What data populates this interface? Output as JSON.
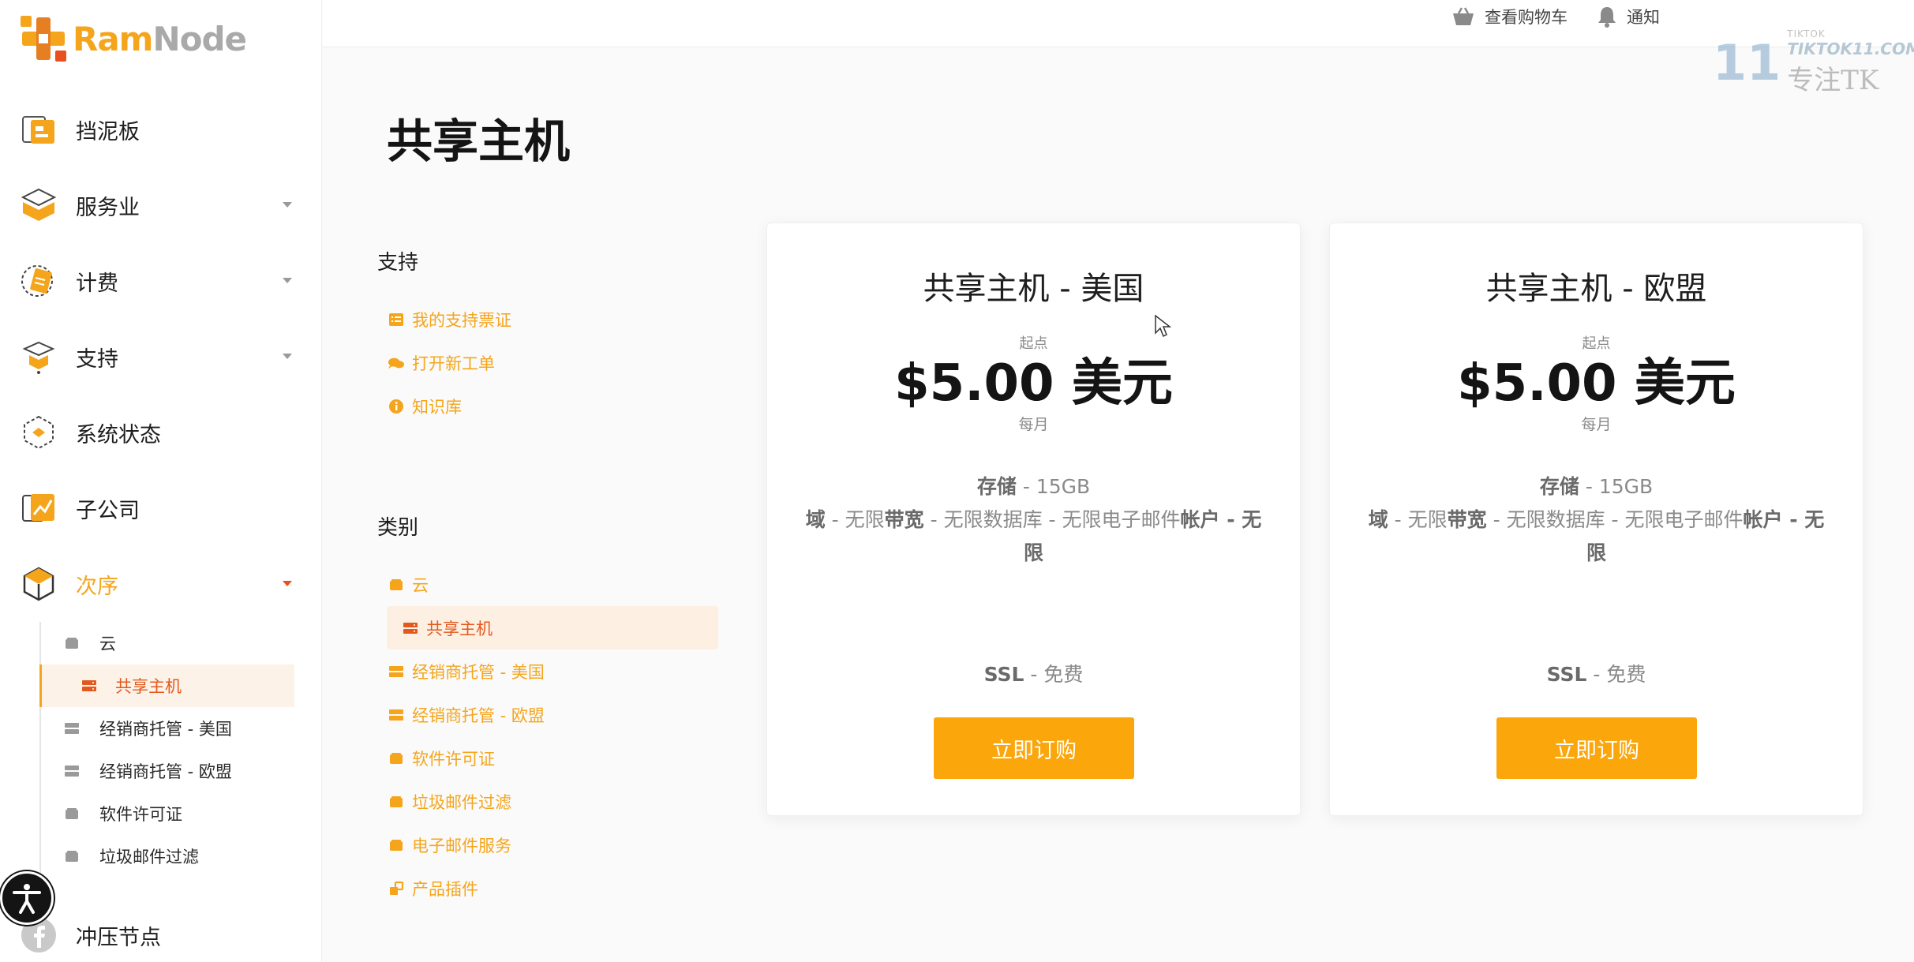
{
  "brand": {
    "name_part1": "Ram",
    "name_part2": "Node",
    "accent": "#f5a51c",
    "secondary": "#e2591e"
  },
  "sidebar": {
    "items": [
      {
        "label": "挡泥板",
        "icon": "dashboard-icon",
        "expandable": false
      },
      {
        "label": "服务业",
        "icon": "services-box-icon",
        "expandable": true
      },
      {
        "label": "计费",
        "icon": "billing-icon",
        "expandable": true
      },
      {
        "label": "支持",
        "icon": "support-icon",
        "expandable": true
      },
      {
        "label": "系统状态",
        "icon": "system-status-icon",
        "expandable": false
      },
      {
        "label": "子公司",
        "icon": "affiliate-icon",
        "expandable": false
      },
      {
        "label": "次序",
        "icon": "order-cube-icon",
        "expandable": true,
        "active": true
      }
    ],
    "subitems": [
      {
        "label": "云",
        "icon": "box-icon"
      },
      {
        "label": "共享主机",
        "icon": "server-icon",
        "active": true
      },
      {
        "label": "经销商托管 - 美国",
        "icon": "server-icon"
      },
      {
        "label": "经销商托管 - 欧盟",
        "icon": "server-icon"
      },
      {
        "label": "软件许可证",
        "icon": "box-icon"
      },
      {
        "label": "垃圾邮件过滤",
        "icon": "box-icon"
      }
    ],
    "bottom_item": {
      "label": "冲压节点",
      "icon": "facebook-icon"
    }
  },
  "topbar": {
    "cart_label": "查看购物车",
    "notifications_label": "通知"
  },
  "watermark": {
    "number": "11",
    "small": "TIKTOK",
    "site": "TIKTOK11.COM",
    "cn": "专注TK"
  },
  "page": {
    "title": "共享主机"
  },
  "support": {
    "heading": "支持",
    "links": [
      {
        "label": "我的支持票证",
        "icon": "list-icon"
      },
      {
        "label": "打开新工单",
        "icon": "comments-icon"
      },
      {
        "label": "知识库",
        "icon": "info-icon"
      }
    ]
  },
  "categories": {
    "heading": "类别",
    "links": [
      {
        "label": "云",
        "icon": "box-icon"
      },
      {
        "label": "共享主机",
        "icon": "server-icon",
        "active": true
      },
      {
        "label": "经销商托管 - 美国",
        "icon": "server-icon"
      },
      {
        "label": "经销商托管 - 欧盟",
        "icon": "server-icon"
      },
      {
        "label": "软件许可证",
        "icon": "box-icon"
      },
      {
        "label": "垃圾邮件过滤",
        "icon": "box-icon"
      },
      {
        "label": "电子邮件服务",
        "icon": "box-icon"
      },
      {
        "label": "产品插件",
        "icon": "cubes-icon"
      }
    ]
  },
  "products": [
    {
      "title": "共享主机 - 美国",
      "from_label": "起点",
      "price": "$5.00 美元",
      "period": "每月",
      "storage_label": "存储",
      "storage_value": "- 15GB",
      "domains_label": "域",
      "domains_value": "- 无限",
      "bandwidth_label": "带宽",
      "bandwidth_value": "- 无限数据库 - 无限电子邮件",
      "accounts_label": "帐户 - 无限",
      "ssl_label": "SSL",
      "ssl_value": "- 免费",
      "button": "立即订购"
    },
    {
      "title": "共享主机 - 欧盟",
      "from_label": "起点",
      "price": "$5.00 美元",
      "period": "每月",
      "storage_label": "存储",
      "storage_value": "- 15GB",
      "domains_label": "域",
      "domains_value": "- 无限",
      "bandwidth_label": "带宽",
      "bandwidth_value": "- 无限数据库 - 无限电子邮件",
      "accounts_label": "帐户 - 无限",
      "ssl_label": "SSL",
      "ssl_value": "- 免费",
      "button": "立即订购"
    }
  ]
}
